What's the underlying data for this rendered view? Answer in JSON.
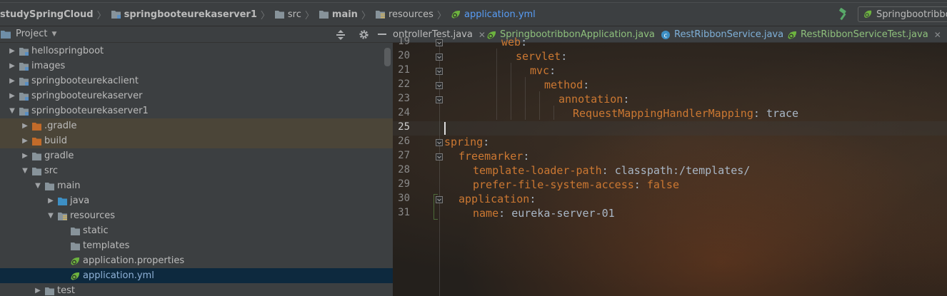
{
  "navbar": {
    "crumbs": [
      {
        "label": "studySpringCloud",
        "bold": true,
        "icon": "none"
      },
      {
        "label": "springbooteurekaserver1",
        "bold": true,
        "icon": "module-folder-icon"
      },
      {
        "label": "src",
        "bold": false,
        "icon": "folder-icon"
      },
      {
        "label": "main",
        "bold": true,
        "icon": "folder-icon"
      },
      {
        "label": "resources",
        "bold": false,
        "icon": "resources-folder-icon"
      },
      {
        "label": "application.yml",
        "bold": false,
        "icon": "spring-yml-icon",
        "active": true
      }
    ],
    "run_config": "Springbootribbon"
  },
  "project": {
    "title": "Project",
    "tree": [
      {
        "label": "hellospringboot",
        "depth": 0,
        "arrow": "right",
        "icon": "module"
      },
      {
        "label": "images",
        "depth": 0,
        "arrow": "right",
        "icon": "module"
      },
      {
        "label": "springbooteurekaclient",
        "depth": 0,
        "arrow": "right",
        "icon": "module"
      },
      {
        "label": "springbooteurekaserver",
        "depth": 0,
        "arrow": "right",
        "icon": "module"
      },
      {
        "label": "springbooteurekaserver1",
        "depth": 0,
        "arrow": "down",
        "icon": "module"
      },
      {
        "label": ".gradle",
        "depth": 1,
        "arrow": "right",
        "icon": "orange",
        "hl": true
      },
      {
        "label": "build",
        "depth": 1,
        "arrow": "right",
        "icon": "orange",
        "hl": true
      },
      {
        "label": "gradle",
        "depth": 1,
        "arrow": "right",
        "icon": "folder"
      },
      {
        "label": "src",
        "depth": 1,
        "arrow": "down",
        "icon": "folder"
      },
      {
        "label": "main",
        "depth": 2,
        "arrow": "down",
        "icon": "folder"
      },
      {
        "label": "java",
        "depth": 3,
        "arrow": "right",
        "icon": "blue"
      },
      {
        "label": "resources",
        "depth": 3,
        "arrow": "down",
        "icon": "resources"
      },
      {
        "label": "static",
        "depth": 4,
        "arrow": "none",
        "icon": "folder"
      },
      {
        "label": "templates",
        "depth": 4,
        "arrow": "none",
        "icon": "folder"
      },
      {
        "label": "application.properties",
        "depth": 4,
        "arrow": "none",
        "icon": "spring"
      },
      {
        "label": "application.yml",
        "depth": 4,
        "arrow": "none",
        "icon": "spring",
        "sel": true
      },
      {
        "label": "test",
        "depth": 2,
        "arrow": "right",
        "icon": "folder"
      }
    ]
  },
  "editor": {
    "tabs": [
      {
        "label": "ontrollerTest.java",
        "style": "plain",
        "icon": "none"
      },
      {
        "label": "SpringbootribbonApplication.java",
        "style": "green",
        "icon": "spring-class"
      },
      {
        "label": "RestRibbonService.java",
        "style": "blue",
        "icon": "class"
      },
      {
        "label": "RestRibbonServiceTest.java",
        "style": "green",
        "icon": "spring-class"
      }
    ],
    "lines": [
      {
        "n": "19",
        "indent": 4,
        "key": "web",
        "colon": ":",
        "value": ""
      },
      {
        "n": "20",
        "indent": 5,
        "key": "servlet",
        "colon": ":",
        "value": ""
      },
      {
        "n": "21",
        "indent": 6,
        "key": "mvc",
        "colon": ":",
        "value": ""
      },
      {
        "n": "22",
        "indent": 7,
        "key": "method",
        "colon": ":",
        "value": ""
      },
      {
        "n": "23",
        "indent": 8,
        "key": "annotation",
        "colon": ":",
        "value": ""
      },
      {
        "n": "24",
        "indent": 9,
        "key": "RequestMappingHandlerMapping",
        "colon": ": ",
        "value": "trace"
      },
      {
        "n": "25",
        "indent": 0,
        "key": "",
        "colon": "",
        "value": "",
        "current": true
      },
      {
        "n": "26",
        "indent": 0,
        "key": "spring",
        "colon": ":",
        "value": ""
      },
      {
        "n": "27",
        "indent": 1,
        "key": "freemarker",
        "colon": ":",
        "value": ""
      },
      {
        "n": "28",
        "indent": 2,
        "key": "template-loader-path",
        "colon": ": ",
        "value": "classpath:/templates/"
      },
      {
        "n": "29",
        "indent": 2,
        "key": "prefer-file-system-access",
        "colon": ": ",
        "value": "false",
        "value_kw": true
      },
      {
        "n": "30",
        "indent": 1,
        "key": "application",
        "colon": ":",
        "value": ""
      },
      {
        "n": "31",
        "indent": 2,
        "key": "name",
        "colon": ": ",
        "value": "eureka-server-01"
      }
    ]
  },
  "colors": {
    "key": "#cc7832",
    "plain": "#a9b7c6",
    "selection": "#0d293e",
    "highlight": "#4b4538"
  }
}
